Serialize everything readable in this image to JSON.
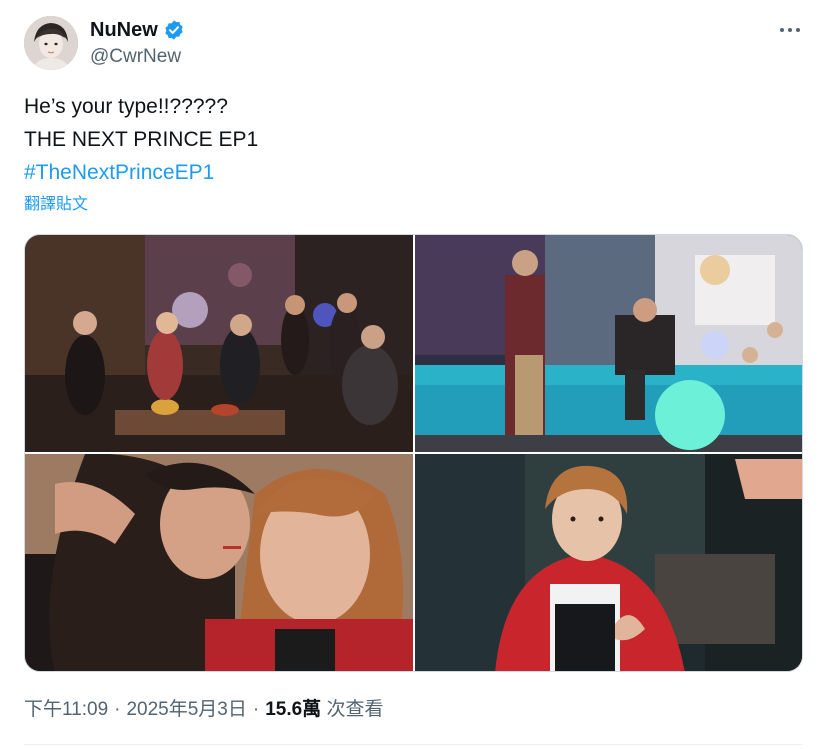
{
  "author": {
    "display_name": "NuNew",
    "handle": "@CwrNew",
    "verified": true,
    "avatar_icon": "profile-photo",
    "verified_icon": "verified-badge-icon",
    "verified_color": "#1d9bf0"
  },
  "more_icon": "more-horizontal-icon",
  "tweet": {
    "line1": "He’s your type!!?????",
    "line2": "THE NEXT PRINCE EP1",
    "hashtag": "#TheNextPrinceEP1",
    "translate_label": "翻譯貼文"
  },
  "media": {
    "count": 4
  },
  "meta": {
    "time": "下午11:09",
    "sep1": "·",
    "date": "2025年5月3日",
    "sep2": "·",
    "views_count": "15.6萬",
    "views_label": "次查看"
  },
  "colors": {
    "text": "#0f1419",
    "secondary": "#536471",
    "link": "#1d9bf0",
    "border": "#cfd9de"
  }
}
